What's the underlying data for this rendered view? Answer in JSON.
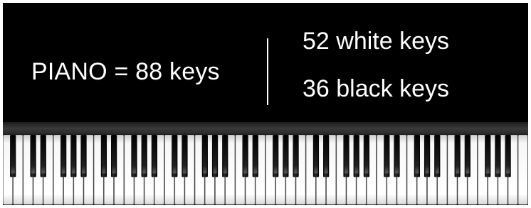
{
  "headline": "PIANO = 88 keys",
  "counts": {
    "white_keys": "52 white keys",
    "black_keys": "36 black keys"
  },
  "keyboard": {
    "total_keys": 88,
    "white_key_count": 52,
    "black_key_count": 36
  },
  "colors": {
    "background": "#000000",
    "text": "#ffffff",
    "white_key": "#f4f4f4",
    "black_key": "#0a0a0a"
  }
}
